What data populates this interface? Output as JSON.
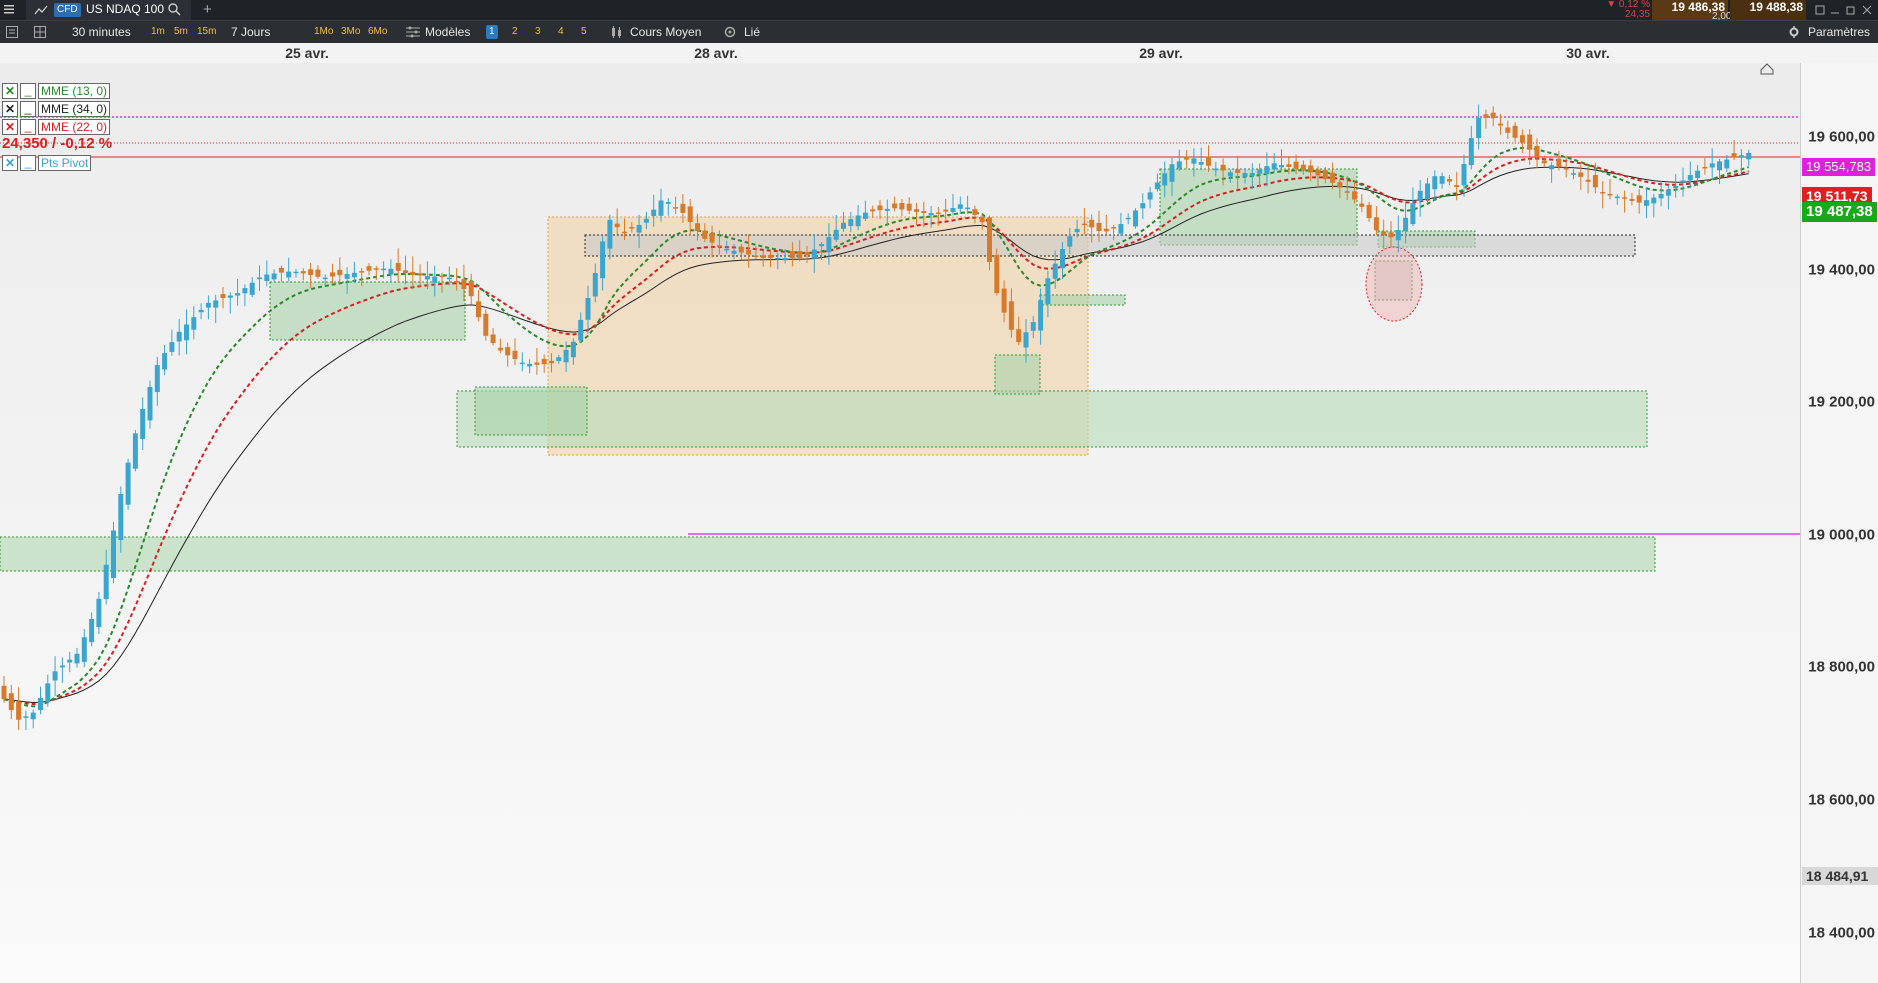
{
  "window": {
    "instrument_tag": "CFD",
    "instrument_name": "US NDAQ 100",
    "change_pct": "▼ 0,12 %",
    "change_abs": "24,35",
    "bid": "19 486,38",
    "spread": "2,00",
    "ask": "19 488,38"
  },
  "toolbar": {
    "timeframe": "30 minutes",
    "intervals": [
      "1m",
      "5m",
      "15m"
    ],
    "period": "7 Jours",
    "ranges": [
      "1Mo",
      "3Mo",
      "6Mo"
    ],
    "templates_label": "Modèles",
    "layouts": [
      "1",
      "2",
      "3",
      "4",
      "5"
    ],
    "price_type": "Cours Moyen",
    "link_label": "Lié",
    "settings_label": "Paramètres"
  },
  "dates": [
    "25 avr.",
    "28 avr.",
    "29 avr.",
    "30 avr."
  ],
  "legend": [
    {
      "label": "MME (13, 0)",
      "color": "#2a8a2a"
    },
    {
      "label": "MME (34, 0)",
      "color": "#222222"
    },
    {
      "label": "MME (22, 0)",
      "color": "#d62020"
    },
    {
      "label": "Pts Pivot",
      "color": "#3aa0d0"
    }
  ],
  "legend_value": "24,350 / -0,12 %",
  "axis": {
    "ticks": [
      "19 600,00",
      "19 400,00",
      "19 200,00",
      "19 000,00",
      "18 800,00",
      "18 600,00",
      "18 400,00"
    ],
    "tick_values": [
      19600,
      19400,
      19200,
      19000,
      18800,
      18600,
      18400
    ],
    "price_min": 18324,
    "price_max": 19712
  },
  "price_labels": {
    "magenta": {
      "text": "19 554,783",
      "value": 19554.783,
      "color": "#e020e0"
    },
    "prev_close": {
      "text": "19 511,73",
      "value": 19511.73,
      "color": "#e02020"
    },
    "current": {
      "text": "19 487,38",
      "value": 19487.38,
      "color": "#18a818"
    },
    "low": {
      "text": "18 484,91",
      "value": 18484.91,
      "color": "#d8d8d8"
    }
  },
  "colors": {
    "up": "#3aa6d0",
    "down": "#d87a2a",
    "ema13": "#2a8a2a",
    "ema22": "#d62020",
    "ema34": "#222222",
    "zone_green": "#2a9a2a",
    "zone_orange": "#e8a030"
  }
}
